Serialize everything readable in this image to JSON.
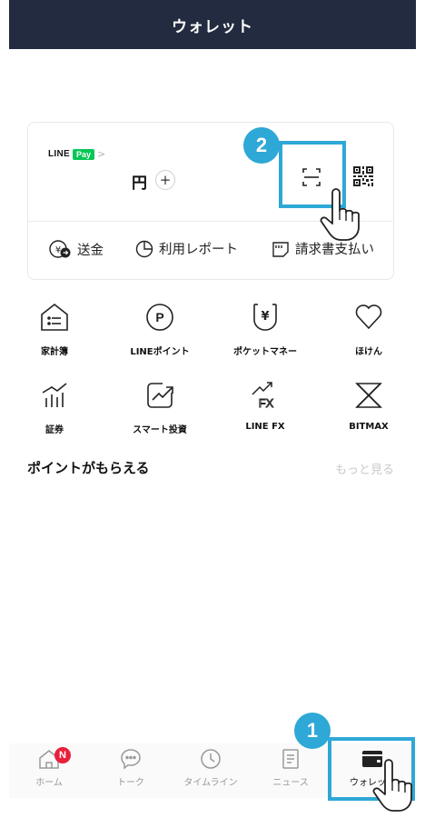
{
  "header": {
    "title": "ウォレット"
  },
  "card": {
    "line_label": "LINE",
    "pay_label": "Pay",
    "chevron": ">",
    "yen": "円",
    "plus": "+",
    "actions": [
      {
        "label": "送金",
        "icon": "send-money-icon"
      },
      {
        "label": "利用レポート",
        "icon": "pie-chart-icon"
      },
      {
        "label": "請求書支払い",
        "icon": "bill-icon"
      }
    ]
  },
  "services": [
    {
      "label": "家計簿",
      "icon": "household-ledger-icon"
    },
    {
      "label": "LINEポイント",
      "icon": "points-icon"
    },
    {
      "label": "ポケットマネー",
      "icon": "pocket-money-icon"
    },
    {
      "label": "ほけん",
      "icon": "heart-icon"
    },
    {
      "label": "証券",
      "icon": "securities-icon"
    },
    {
      "label": "スマート投資",
      "icon": "smart-investment-icon"
    },
    {
      "label": "LINE FX",
      "icon": "fx-icon"
    },
    {
      "label": "BITMAX",
      "icon": "bitmax-icon"
    }
  ],
  "points": {
    "title": "ポイントがもらえる",
    "more": "もっと見る"
  },
  "bottom_nav": [
    {
      "label": "ホーム",
      "icon": "home-icon",
      "badge": "N"
    },
    {
      "label": "トーク",
      "icon": "chat-icon"
    },
    {
      "label": "タイムライン",
      "icon": "clock-icon"
    },
    {
      "label": "ニュース",
      "icon": "news-icon"
    },
    {
      "label": "ウォレット",
      "icon": "wallet-icon",
      "active": true
    }
  ],
  "annotations": {
    "step1": "1",
    "step2": "2"
  },
  "colors": {
    "header_bg": "#222b3f",
    "accent_blue": "#2ea8d6",
    "line_green": "#06c755",
    "badge_red": "#e8203a"
  }
}
